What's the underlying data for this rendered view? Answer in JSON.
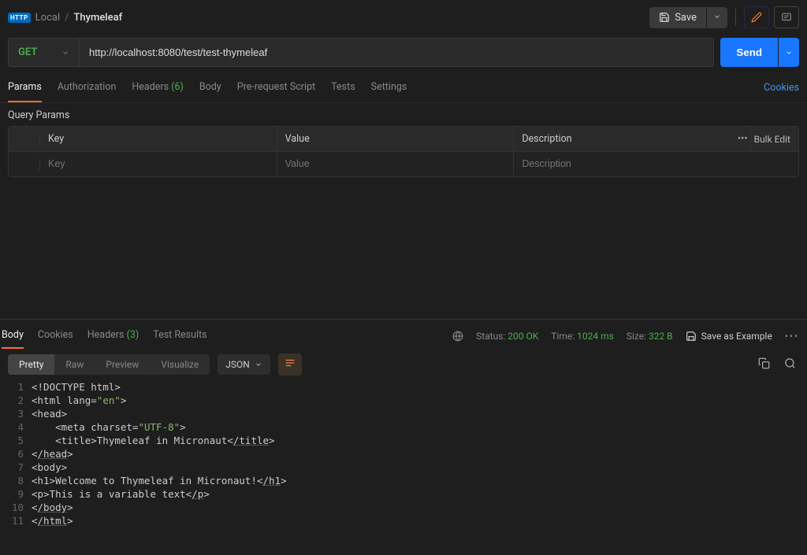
{
  "breadcrumb": {
    "http_badge": "HTTP",
    "local": "Local",
    "current": "Thymeleaf"
  },
  "header": {
    "save_label": "Save"
  },
  "request": {
    "method": "GET",
    "url": "http://localhost:8080/test/test-thymeleaf",
    "send_label": "Send"
  },
  "tabs": {
    "params": "Params",
    "authorization": "Authorization",
    "headers": "Headers",
    "headers_count": "(6)",
    "body": "Body",
    "prerequest": "Pre-request Script",
    "tests": "Tests",
    "settings": "Settings",
    "cookies": "Cookies"
  },
  "query_params": {
    "title": "Query Params",
    "key_header": "Key",
    "value_header": "Value",
    "desc_header": "Description",
    "bulk_edit": "Bulk Edit",
    "key_ph": "Key",
    "value_ph": "Value",
    "desc_ph": "Description"
  },
  "response": {
    "tabs": {
      "body": "Body",
      "cookies": "Cookies",
      "headers": "Headers",
      "headers_count": "(3)",
      "test_results": "Test Results"
    },
    "meta": {
      "status_label": "Status:",
      "status_value": "200 OK",
      "time_label": "Time:",
      "time_value": "1024 ms",
      "size_label": "Size:",
      "size_value": "322 B",
      "save_example": "Save as Example"
    },
    "view": {
      "pretty": "Pretty",
      "raw": "Raw",
      "preview": "Preview",
      "visualize": "Visualize",
      "format": "JSON"
    },
    "code": [
      [
        {
          "t": "<!DOCTYPE html>"
        }
      ],
      [
        {
          "t": "<html lang="
        },
        {
          "t": "\"en\"",
          "c": "str"
        },
        {
          "t": ">"
        }
      ],
      [
        {
          "t": "<head>"
        }
      ],
      [
        {
          "t": "    <meta charset="
        },
        {
          "t": "\"UTF-8\"",
          "c": "str"
        },
        {
          "t": ">"
        }
      ],
      [
        {
          "t": "    <title>Thymeleaf in Micronaut<"
        },
        {
          "t": "/title",
          "c": "tag-close"
        },
        {
          "t": ">"
        }
      ],
      [
        {
          "t": "<"
        },
        {
          "t": "/head",
          "c": "tag-close"
        },
        {
          "t": ">"
        }
      ],
      [
        {
          "t": "<body>"
        }
      ],
      [
        {
          "t": "<h1>Welcome to Thymeleaf in Micronaut!<"
        },
        {
          "t": "/h1",
          "c": "tag-close"
        },
        {
          "t": ">"
        }
      ],
      [
        {
          "t": "<p>This is a variable text<"
        },
        {
          "t": "/p",
          "c": "tag-close"
        },
        {
          "t": ">"
        }
      ],
      [
        {
          "t": "<"
        },
        {
          "t": "/body",
          "c": "tag-close"
        },
        {
          "t": ">"
        }
      ],
      [
        {
          "t": "<"
        },
        {
          "t": "/html",
          "c": "tag-close"
        },
        {
          "t": ">"
        }
      ]
    ]
  }
}
